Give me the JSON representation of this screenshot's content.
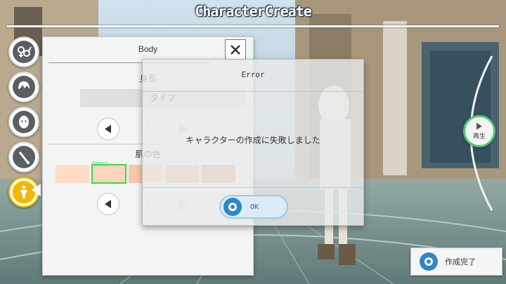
{
  "header": {
    "title": "CharacterCreate"
  },
  "side_menu": {
    "items": [
      {
        "icon": "gender-icon",
        "active": false
      },
      {
        "icon": "hair-icon",
        "active": false
      },
      {
        "icon": "face-icon",
        "active": false
      },
      {
        "icon": "brush-icon",
        "active": false
      },
      {
        "icon": "body-icon",
        "active": true
      }
    ]
  },
  "panel": {
    "title": "Body",
    "close_icon": "close-icon",
    "height_label": "身長",
    "type_value": "タイプ",
    "type_index": "3",
    "skin_label": "肌の色",
    "skin_index": "3",
    "select_tag": "Select",
    "skin_swatches": [
      "#ffdcc6",
      "#fdd4bd",
      "#f7c7ab",
      "#eab99c",
      "#d9a786"
    ],
    "selected_swatch": 1
  },
  "dialog": {
    "title": "Error",
    "message": "キャラクターの作成に失敗しました",
    "ok_label": "OK"
  },
  "play_button": {
    "label": "再生"
  },
  "finish_button": {
    "label": "作成完了"
  },
  "colors": {
    "accent_blue": "#2f86c9",
    "select_green": "#2ee04a",
    "active_yellow": "#f2b800"
  }
}
